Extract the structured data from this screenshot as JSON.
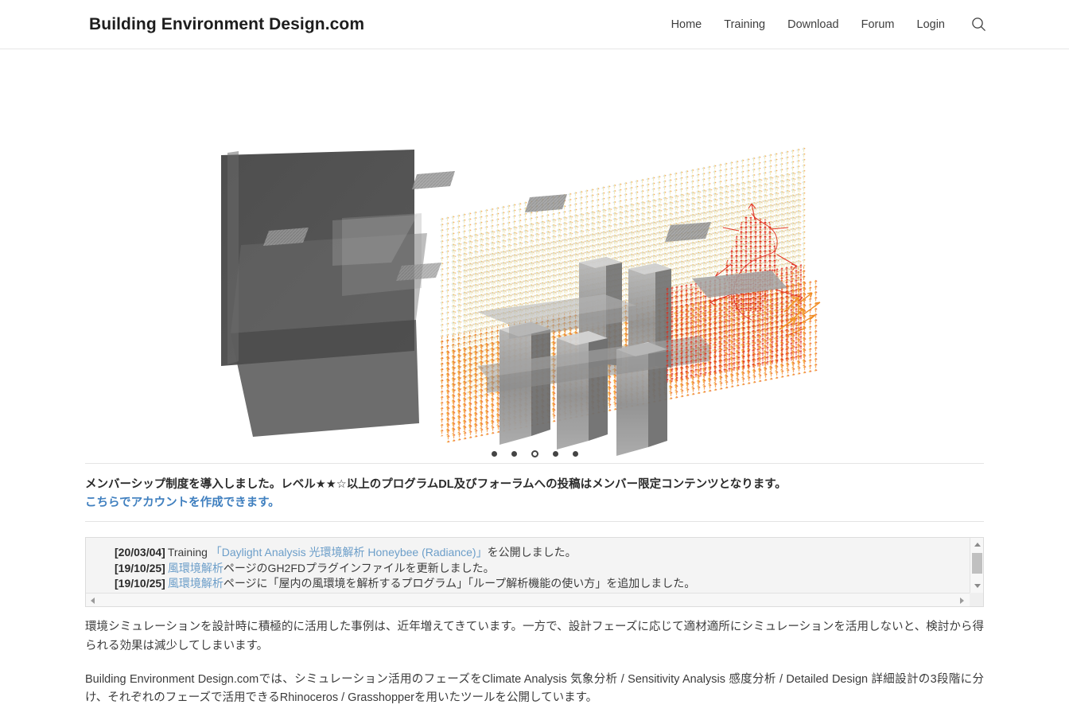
{
  "header": {
    "site_title": "Building Environment Design.com",
    "nav": [
      {
        "label": "Home"
      },
      {
        "label": "Training"
      },
      {
        "label": "Download"
      },
      {
        "label": "Forum"
      },
      {
        "label": "Login"
      }
    ],
    "search_icon": "search-icon"
  },
  "hero": {
    "alt": "CFD wind environment simulation of building massing with colored vector arrow field",
    "carousel": {
      "total_slides": 5,
      "active_index": 3
    }
  },
  "notice": {
    "text": "メンバーシップ制度を導入しました。レベル★★☆以上のプログラムDL及びフォーラムへの投稿はメンバー限定コンテンツとなります。",
    "link_text": "こちらでアカウントを作成できます。"
  },
  "news": {
    "items": [
      {
        "date": "[20/03/04]",
        "pre": "Training ",
        "link": "「Daylight Analysis 光環境解析 Honeybee (Radiance)」",
        "post": "を公開しました。"
      },
      {
        "date": "[19/10/25]",
        "pre": "",
        "link": "風環境解析",
        "post": "ページのGH2FDプラグインファイルを更新しました。"
      },
      {
        "date": "[19/10/25]",
        "pre": "",
        "link": "風環境解析",
        "post": "ページに「屋内の風環境を解析するプログラム」「ループ解析機能の使い方」を追加しました。"
      }
    ],
    "scrollbar": {
      "up_arrow": "triangle-up-icon",
      "down_arrow": "triangle-down-icon",
      "left_arrow": "triangle-left-icon",
      "right_arrow": "triangle-right-icon"
    }
  },
  "body": {
    "paragraph_1": "環境シミュレーションを設計時に積極的に活用した事例は、近年増えてきています。一方で、設計フェーズに応じて適材適所にシミュレーションを活用しないと、検討から得られる効果は減少してしまいます。",
    "paragraph_2": "Building Environment Design.comでは、シミュレーション活用のフェーズをClimate Analysis 気象分析 / Sensitivity Analysis 感度分析 / Detailed Design 詳細設計の3段階に分け、それぞれのフェーズで活用できるRhinoceros / Grasshopperを用いたツールを公開しています。"
  },
  "colors": {
    "link_blue": "#3f7fbf",
    "news_link_blue": "#6c9ec9",
    "text": "#3b3b3b",
    "rule": "#e4e4e4",
    "news_bg": "#f4f4f4"
  }
}
